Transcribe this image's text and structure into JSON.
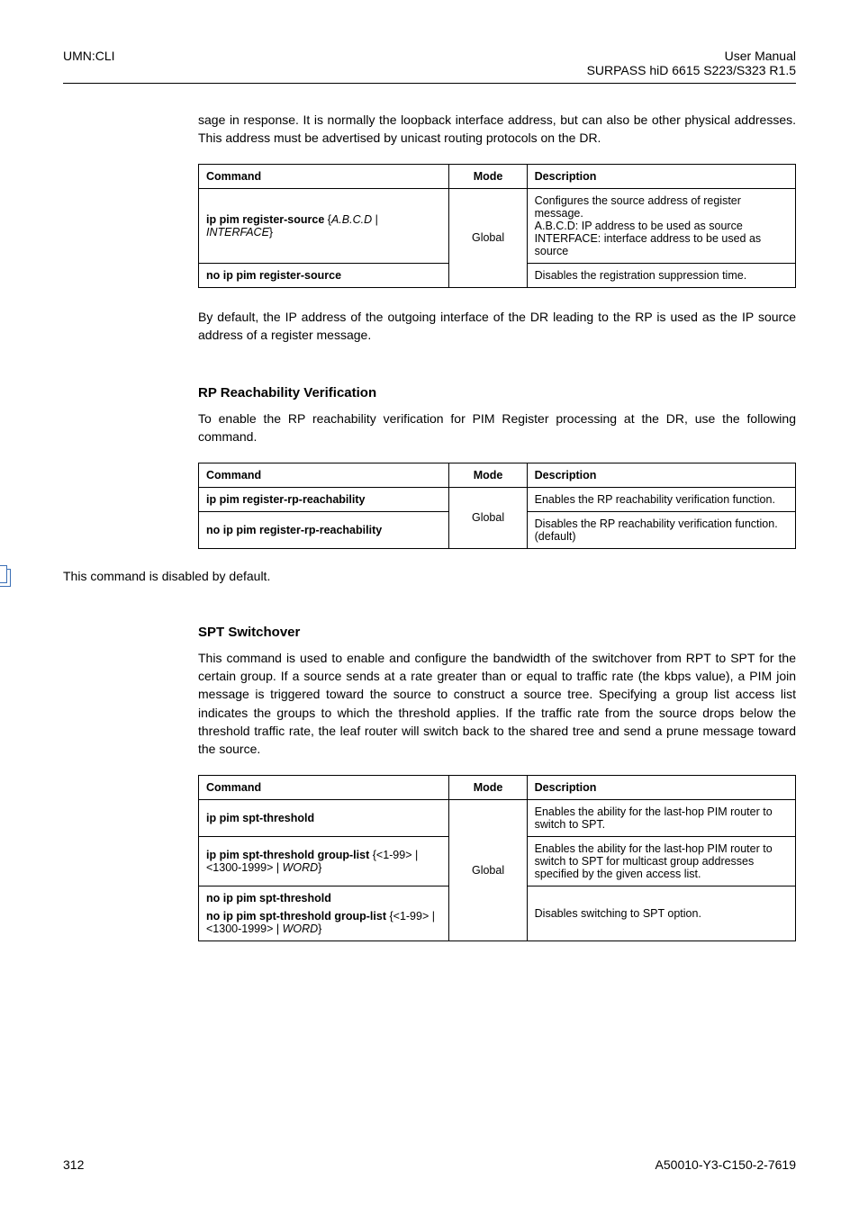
{
  "header": {
    "left": "UMN:CLI",
    "right_line1": "User Manual",
    "right_line2": "SURPASS hiD 6615 S223/S323 R1.5"
  },
  "intro_para": "sage in response. It is normally the loopback interface address, but can also be other physical addresses. This address must be advertised by unicast routing protocols on the DR.",
  "table1": {
    "h1": "Command",
    "h2": "Mode",
    "h3": "Description",
    "r1_cmd_a": "ip pim register-source ",
    "r1_cmd_b": "{",
    "r1_cmd_c": "A.B.C.D",
    "r1_cmd_d": " | ",
    "r1_cmd_e": "INTERFACE",
    "r1_cmd_f": "}",
    "mode": "Global",
    "r1_desc_l1": "Configures the source address of register message.",
    "r1_desc_l2": "A.B.C.D: IP address to be used as source",
    "r1_desc_l3": "INTERFACE: interface address to be used as source",
    "r2_cmd": "no ip pim register-source",
    "r2_desc": "Disables the registration suppression time."
  },
  "para_after_t1": "By default, the IP address of the outgoing interface of the DR leading to the RP is used as the IP source address of a register message.",
  "section_rp": {
    "title": "RP Reachability Verification",
    "para": "To enable the RP reachability verification for PIM Register processing at the DR, use the following command."
  },
  "table2": {
    "h1": "Command",
    "h2": "Mode",
    "h3": "Description",
    "r1_cmd": "ip pim register-rp-reachability",
    "mode": "Global",
    "r1_desc": "Enables the RP reachability verification function.",
    "r2_cmd": "no ip pim register-rp-reachability",
    "r2_desc_l1": "Disables the RP reachability verification function.",
    "r2_desc_l2": "(default)"
  },
  "note_text": "This command is disabled by default.",
  "section_spt": {
    "title": "SPT Switchover",
    "para": "This command is used to enable and configure the bandwidth of the switchover from RPT to SPT for the certain group. If a source sends at a rate greater than or equal to traffic rate (the kbps value), a PIM join message is triggered toward the source to construct a source tree. Specifying a group list access list indicates the groups to which the threshold applies. If the traffic rate from the source drops below the threshold traffic rate, the leaf router will switch back to the shared tree and send a prune message toward the source."
  },
  "table3": {
    "h1": "Command",
    "h2": "Mode",
    "h3": "Description",
    "r1_cmd": "ip pim spt-threshold",
    "mode": "Global",
    "r1_desc": "Enables the ability for the last-hop PIM router to switch to SPT.",
    "r2_cmd_a": "ip pim spt-threshold group-list ",
    "r2_cmd_b": "{<1-99> | <1300-1999> | ",
    "r2_cmd_c": "WORD",
    "r2_cmd_d": "}",
    "r2_desc": "Enables the ability for the last-hop PIM router to switch to SPT for multicast group addresses specified by the given access list.",
    "r3_cmd_a": "no ip pim spt-threshold",
    "r3_cmd_b": "no ip pim spt-threshold group-list ",
    "r3_cmd_c": "{<1-99> | <1300-1999> | ",
    "r3_cmd_d": "WORD",
    "r3_cmd_e": "}",
    "r3_desc": "Disables switching to SPT option."
  },
  "footer": {
    "left": "312",
    "right": "A50010-Y3-C150-2-7619"
  }
}
